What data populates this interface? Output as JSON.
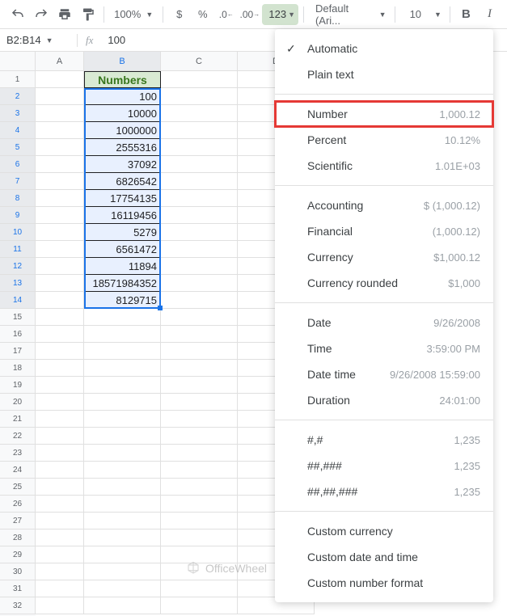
{
  "toolbar": {
    "zoom": "100%",
    "format123": "123",
    "font": "Default (Ari...",
    "fontsize": "10",
    "bold": "B",
    "italic": "I"
  },
  "namebox": {
    "ref": "B2:B14",
    "formula": "100"
  },
  "columns": [
    "A",
    "B",
    "C",
    "D"
  ],
  "header_cell": "Numbers",
  "data_values": [
    "100",
    "10000",
    "1000000",
    "2555316",
    "37092",
    "6826542",
    "17754135",
    "16119456",
    "5279",
    "6561472",
    "11894",
    "18571984352",
    "8129715"
  ],
  "row_count": 32,
  "menu": {
    "items": [
      {
        "label": "Automatic",
        "checked": true
      },
      {
        "label": "Plain text"
      },
      {
        "sep": true
      },
      {
        "label": "Number",
        "example": "1,000.12",
        "highlight": true
      },
      {
        "label": "Percent",
        "example": "10.12%"
      },
      {
        "label": "Scientific",
        "example": "1.01E+03"
      },
      {
        "sep": true
      },
      {
        "label": "Accounting",
        "example": "$ (1,000.12)"
      },
      {
        "label": "Financial",
        "example": "(1,000.12)"
      },
      {
        "label": "Currency",
        "example": "$1,000.12"
      },
      {
        "label": "Currency rounded",
        "example": "$1,000"
      },
      {
        "sep": true
      },
      {
        "label": "Date",
        "example": "9/26/2008"
      },
      {
        "label": "Time",
        "example": "3:59:00 PM"
      },
      {
        "label": "Date time",
        "example": "9/26/2008 15:59:00"
      },
      {
        "label": "Duration",
        "example": "24:01:00"
      },
      {
        "sep": true
      },
      {
        "label": "#,#",
        "example": "1,235"
      },
      {
        "label": "##,###",
        "example": "1,235"
      },
      {
        "label": "##,##,###",
        "example": "1,235"
      },
      {
        "sep": true
      },
      {
        "label": "Custom currency"
      },
      {
        "label": "Custom date and time"
      },
      {
        "label": "Custom number format"
      }
    ]
  },
  "watermark": "OfficeWheel"
}
